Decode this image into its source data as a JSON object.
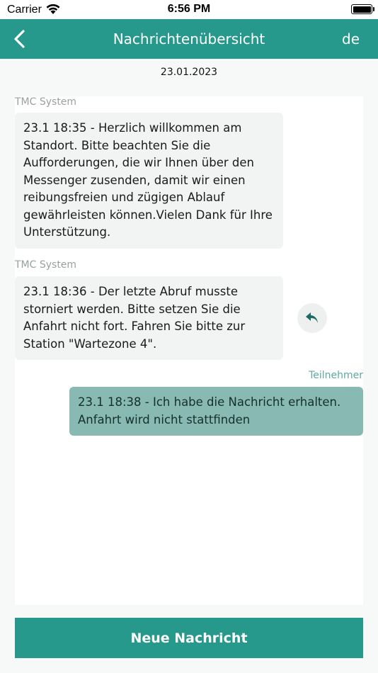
{
  "status_bar": {
    "carrier": "Carrier",
    "time": "6:56 PM"
  },
  "nav": {
    "title": "Nachrichtenübersicht",
    "language": "de"
  },
  "date": "23.01.2023",
  "messages": [
    {
      "sender": "TMC System",
      "text": "23.1 18:35 - Herzlich willkommen am Standort. Bitte beachten Sie die Aufforderungen, die wir Ihnen über den Messenger zusenden, damit wir einen reibungsfreien und zügigen Ablauf gewährleisten können.Vielen Dank für Ihre Unterstützung."
    },
    {
      "sender": "TMC System",
      "text": "23.1 18:36 - Der letzte Abruf musste storniert werden. Bitte setzen Sie die Anfahrt nicht fort. Fahren Sie bitte zur Station \"Wartezone 4\".",
      "reply_icon": "reply-arrow-icon"
    },
    {
      "sender": "Teilnehmer",
      "text": "23.1 18:38 - Ich habe die Nachricht erhalten. Anfahrt wird nicht stattfinden"
    }
  ],
  "footer": {
    "new_message_label": "Neue Nachricht"
  },
  "colors": {
    "primary": "#26998c",
    "own_bubble": "#88bab3",
    "other_bubble": "#f2f3f3"
  }
}
